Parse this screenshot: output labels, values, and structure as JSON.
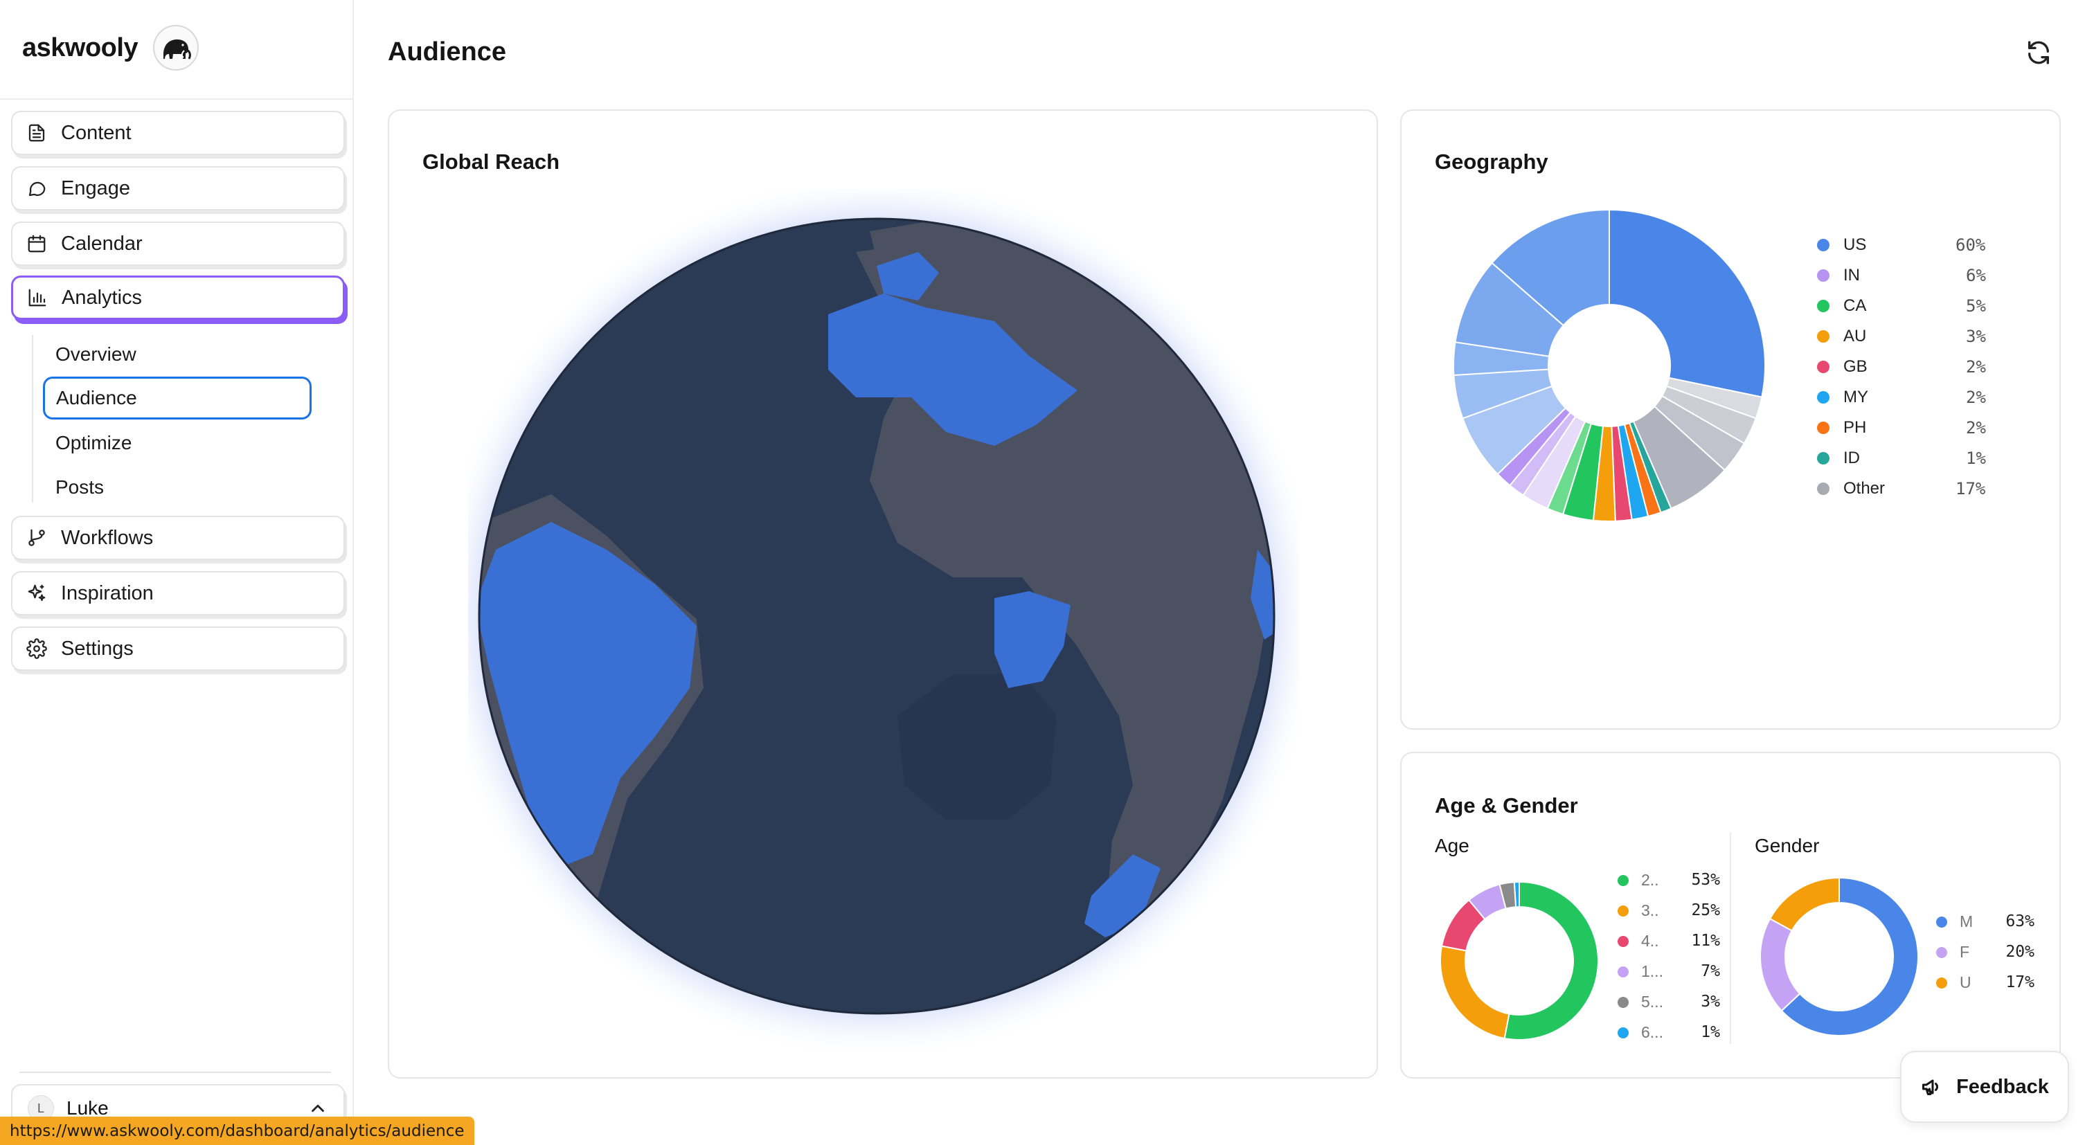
{
  "app": {
    "brand": "askwooly"
  },
  "sidebar": {
    "items": [
      {
        "label": "Content",
        "icon": "document-icon"
      },
      {
        "label": "Engage",
        "icon": "chat-bubble-icon"
      },
      {
        "label": "Calendar",
        "icon": "calendar-icon"
      },
      {
        "label": "Analytics",
        "icon": "bar-chart-icon",
        "active": true
      },
      {
        "label": "Workflows",
        "icon": "git-branch-icon"
      },
      {
        "label": "Inspiration",
        "icon": "sparkles-icon"
      },
      {
        "label": "Settings",
        "icon": "gear-icon"
      }
    ],
    "analytics_sub": [
      {
        "label": "Overview"
      },
      {
        "label": "Audience",
        "selected": true
      },
      {
        "label": "Optimize"
      },
      {
        "label": "Posts"
      }
    ],
    "user": {
      "initial": "L",
      "name": "Luke"
    }
  },
  "header": {
    "title": "Audience"
  },
  "globe": {
    "title": "Global Reach",
    "ocean_color": "#2b3a55",
    "land_color": "#4b5161",
    "highlight_color": "#3a6fd4"
  },
  "geography": {
    "title": "Geography",
    "legend": [
      {
        "label": "US",
        "pct": "60%",
        "color": "#4a86e8"
      },
      {
        "label": "IN",
        "pct": "6%",
        "color": "#b794f4"
      },
      {
        "label": "CA",
        "pct": "5%",
        "color": "#22c55e"
      },
      {
        "label": "AU",
        "pct": "3%",
        "color": "#f59e0b"
      },
      {
        "label": "GB",
        "pct": "2%",
        "color": "#e8486f"
      },
      {
        "label": "MY",
        "pct": "2%",
        "color": "#1ea7f0"
      },
      {
        "label": "PH",
        "pct": "2%",
        "color": "#f97316"
      },
      {
        "label": "ID",
        "pct": "1%",
        "color": "#26a69a"
      },
      {
        "label": "Other",
        "pct": "17%",
        "color": "#a9abb3"
      }
    ]
  },
  "age_gender": {
    "title": "Age & Gender",
    "age": {
      "title": "Age",
      "legend": [
        {
          "label": "2..",
          "pct": "53%",
          "value": 53,
          "color": "#22c55e"
        },
        {
          "label": "3..",
          "pct": "25%",
          "value": 25,
          "color": "#f59e0b"
        },
        {
          "label": "4..",
          "pct": "11%",
          "value": 11,
          "color": "#e8486f"
        },
        {
          "label": "1...",
          "pct": "7%",
          "value": 7,
          "color": "#c4a3f5"
        },
        {
          "label": "5...",
          "pct": "3%",
          "value": 3,
          "color": "#8a8a8a"
        },
        {
          "label": "6...",
          "pct": "1%",
          "value": 1,
          "color": "#1ea7f0"
        }
      ]
    },
    "gender": {
      "title": "Gender",
      "legend": [
        {
          "label": "M",
          "pct": "63%",
          "value": 63,
          "color": "#4a86e8"
        },
        {
          "label": "F",
          "pct": "20%",
          "value": 20,
          "color": "#c4a3f5"
        },
        {
          "label": "U",
          "pct": "17%",
          "value": 17,
          "color": "#f59e0b"
        }
      ]
    }
  },
  "feedback": {
    "label": "Feedback"
  },
  "status_bar": {
    "url": "https://www.askwooly.com/dashboard/analytics/audience"
  }
}
